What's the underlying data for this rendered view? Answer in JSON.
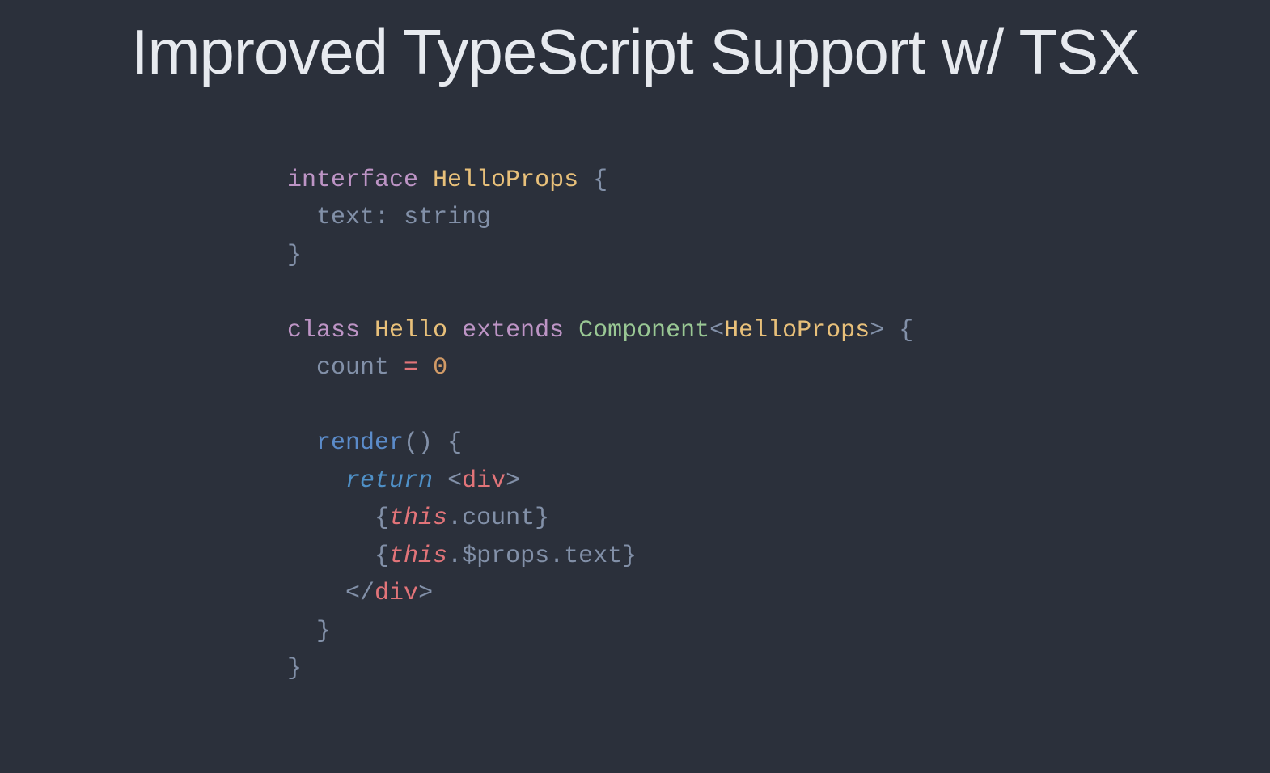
{
  "slide": {
    "title": "Improved TypeScript Support w/ TSX",
    "code": {
      "t_interface": "interface",
      "t_HelloProps": "HelloProps",
      "t_lbrace": "{",
      "t_rbrace": "}",
      "t_text_key": "text",
      "t_colon": ":",
      "t_string": "string",
      "t_class": "class",
      "t_Hello": "Hello",
      "t_extends": "extends",
      "t_Component": "Component",
      "t_lt": "<",
      "t_gt": ">",
      "t_count": "count",
      "t_eq": "=",
      "t_zero": "0",
      "t_render": "render",
      "t_parens": "()",
      "t_return": "return",
      "t_div": "div",
      "t_this": "this",
      "t_dot": ".",
      "t_countMember": "count",
      "t_props": "$props",
      "t_textMember": "text",
      "t_slash": "/",
      "t_sp": " "
    }
  }
}
